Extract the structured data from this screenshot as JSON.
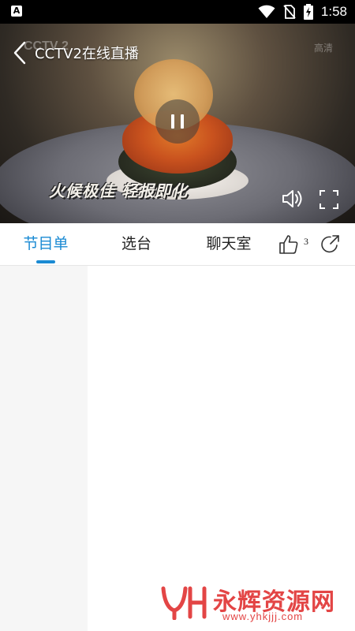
{
  "status_bar": {
    "app_icon_letter": "A",
    "time": "1:58",
    "icons": [
      "wifi-icon",
      "no-sim-icon",
      "battery-charging-icon"
    ]
  },
  "player": {
    "title": "CCTV2在线直播",
    "watermark": "CCTV 2",
    "hd_badge": "高清",
    "burned_subtitle": "火候极佳  轻报即化",
    "state": "playing",
    "controls": [
      "back-icon",
      "pause-icon",
      "volume-icon",
      "fullscreen-icon"
    ]
  },
  "tabs": [
    {
      "label": "节目单",
      "active": true
    },
    {
      "label": "选台",
      "active": false
    },
    {
      "label": "聊天室",
      "active": false
    }
  ],
  "actions": {
    "like_count": "3"
  },
  "watermark": {
    "logo_letters": "YH",
    "name": "永辉资源网",
    "url": "www.yhkjjj.com"
  },
  "colors": {
    "accent": "#1a8ad3",
    "watermark_red": "#e34545",
    "sidebar_bg": "#f6f6f6"
  }
}
